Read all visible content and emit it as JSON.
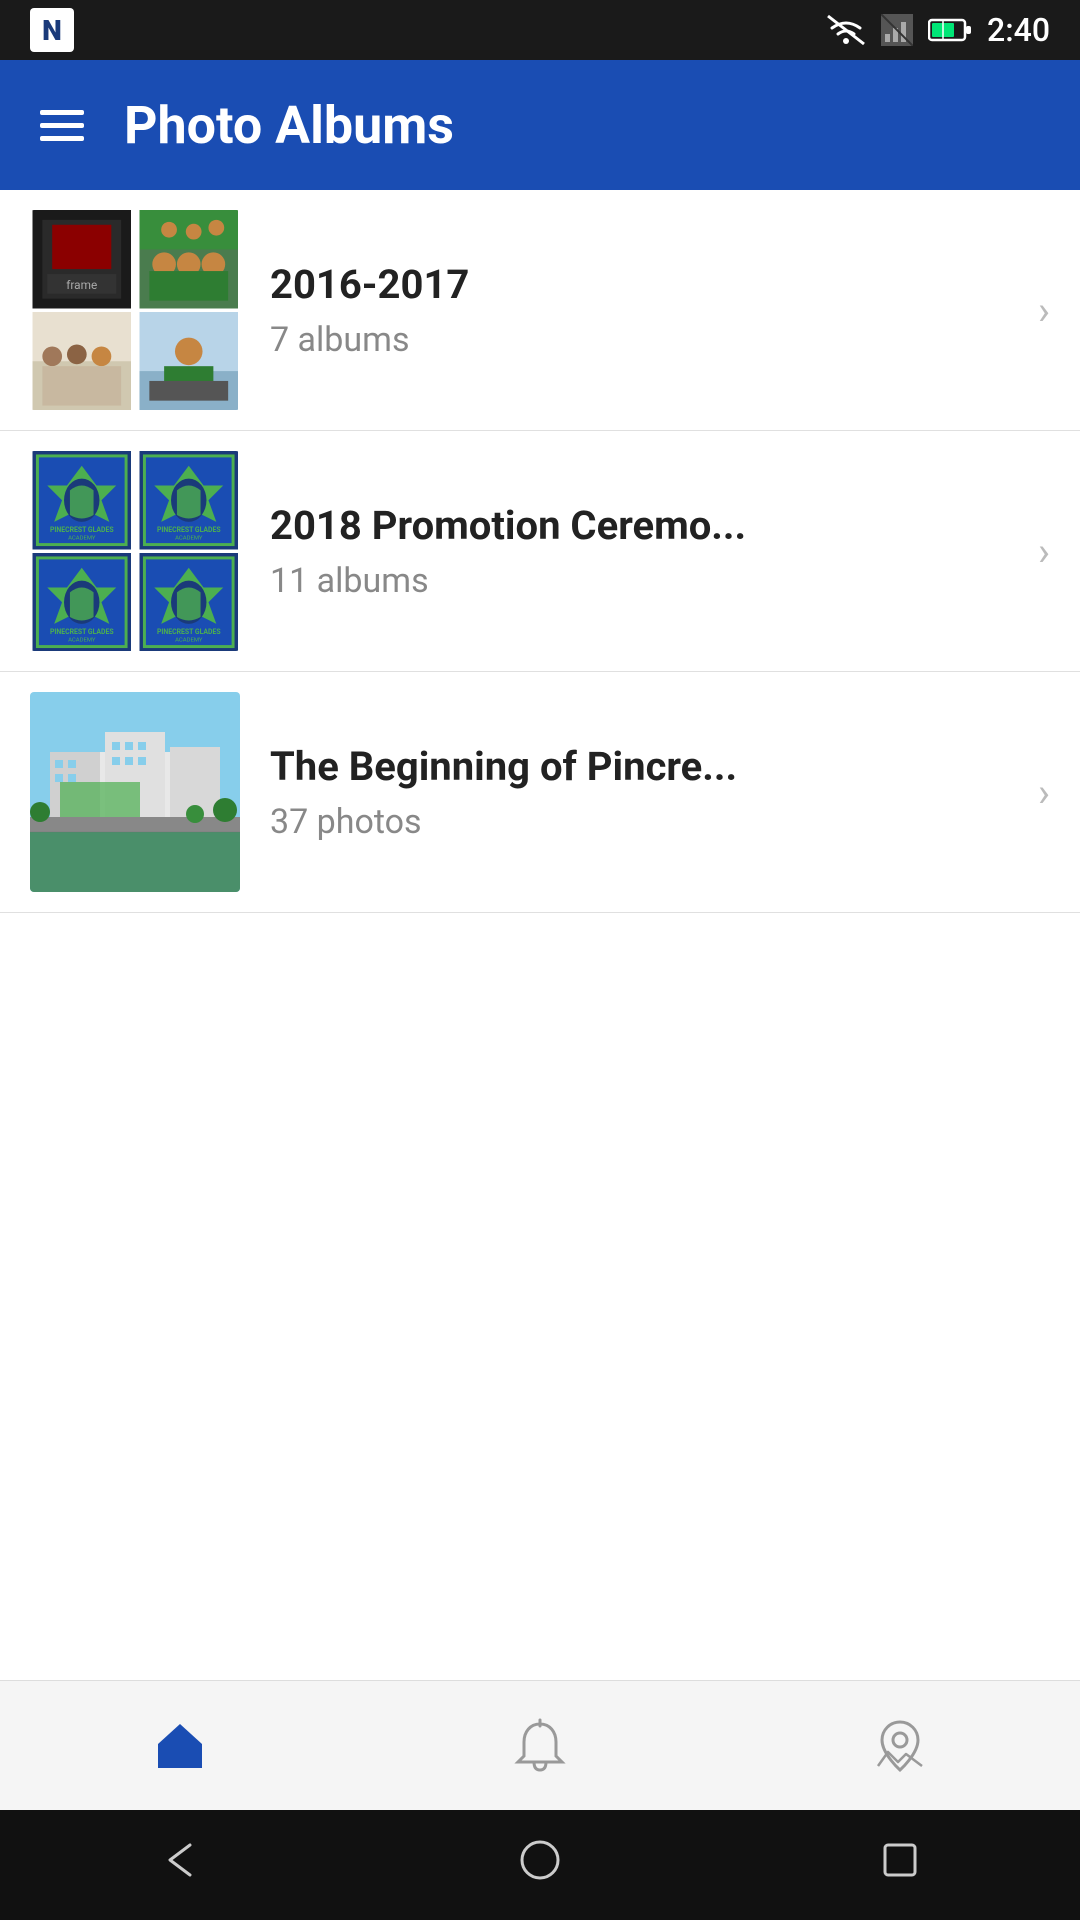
{
  "statusBar": {
    "time": "2:40",
    "appLogo": "N"
  },
  "header": {
    "title": "Photo Albums",
    "menuIcon": "menu-icon"
  },
  "albums": [
    {
      "id": "album-2016-2017",
      "title": "2016-2017",
      "count": "7 albums",
      "thumbnailType": "grid",
      "thumbnails": [
        "photo1",
        "photo2",
        "photo3",
        "photo4"
      ]
    },
    {
      "id": "album-2018-promotion",
      "title": "2018 Promotion Ceremo...",
      "count": "11 albums",
      "thumbnailType": "grid",
      "thumbnails": [
        "logo1",
        "logo2",
        "logo3",
        "logo4"
      ]
    },
    {
      "id": "album-beginning-pincre",
      "title": "The Beginning of Pincre...",
      "count": "37 photos",
      "thumbnailType": "single",
      "thumbnails": [
        "aerial"
      ]
    }
  ],
  "bottomNav": {
    "items": [
      {
        "id": "home",
        "label": "Home",
        "icon": "home-icon",
        "active": true
      },
      {
        "id": "notifications",
        "label": "Notifications",
        "icon": "bell-icon",
        "active": false
      },
      {
        "id": "map",
        "label": "Map",
        "icon": "map-icon",
        "active": false
      }
    ]
  },
  "androidNav": {
    "back": "◁",
    "home": "○",
    "recent": "□"
  }
}
